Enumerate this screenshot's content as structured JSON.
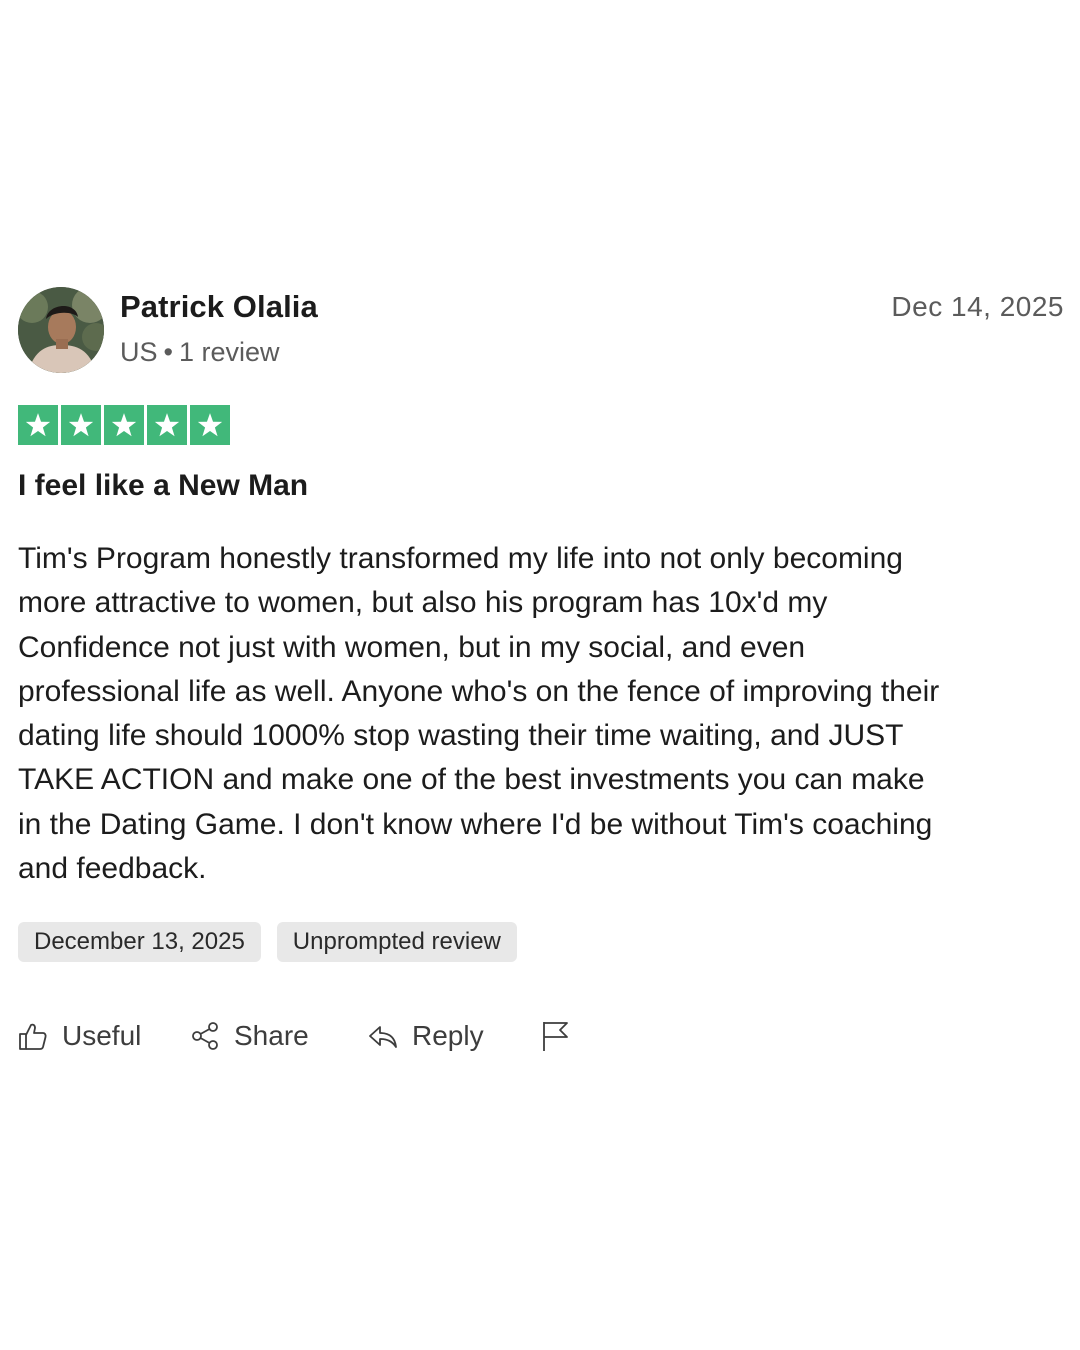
{
  "reviewer": {
    "name": "Patrick Olalia",
    "country": "US",
    "separator": "•",
    "review_count": "1 review"
  },
  "review": {
    "date_top": "Dec 14, 2025",
    "rating": 5,
    "rating_max": 5,
    "star_color": "#41b87a",
    "title": "I feel like a New Man",
    "body_lines": [
      "Tim's Program honestly transformed my life into not only becoming",
      "more attractive to women, but also his program has 10x'd my",
      "Confidence not just with women, but in my social, and even",
      "professional life as well. Anyone who's on the fence of improving their",
      "dating life should 1000% stop wasting their time waiting, and JUST",
      "TAKE ACTION and make one of the best investments you can make",
      "in the Dating Game. I don't know where I'd be without Tim's coaching",
      "and feedback."
    ],
    "tags": {
      "date_of_experience": "December 13, 2025",
      "review_type": "Unprompted review"
    }
  },
  "actions": {
    "useful_label": "Useful",
    "useful_icon": "thumbs-up-icon",
    "share_label": "Share",
    "share_icon": "share-icon",
    "reply_label": "Reply",
    "reply_icon": "reply-icon",
    "flag_icon": "flag-icon"
  }
}
